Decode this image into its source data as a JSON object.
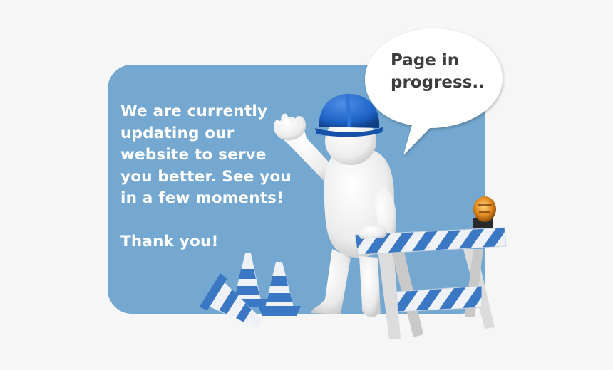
{
  "message": {
    "body": "We are currently updating our website to serve you better. See you in a few moments!",
    "thanks": "Thank you!"
  },
  "speech_bubble": {
    "line1": "Page in",
    "line2": "progress.."
  },
  "colors": {
    "background": "#f6f6f6",
    "panel": "#74a8d0",
    "text": "#ffffff",
    "bubble_text": "#3d3d3d",
    "helmet": "#1d63c6",
    "stripe": "#3b78c4"
  }
}
